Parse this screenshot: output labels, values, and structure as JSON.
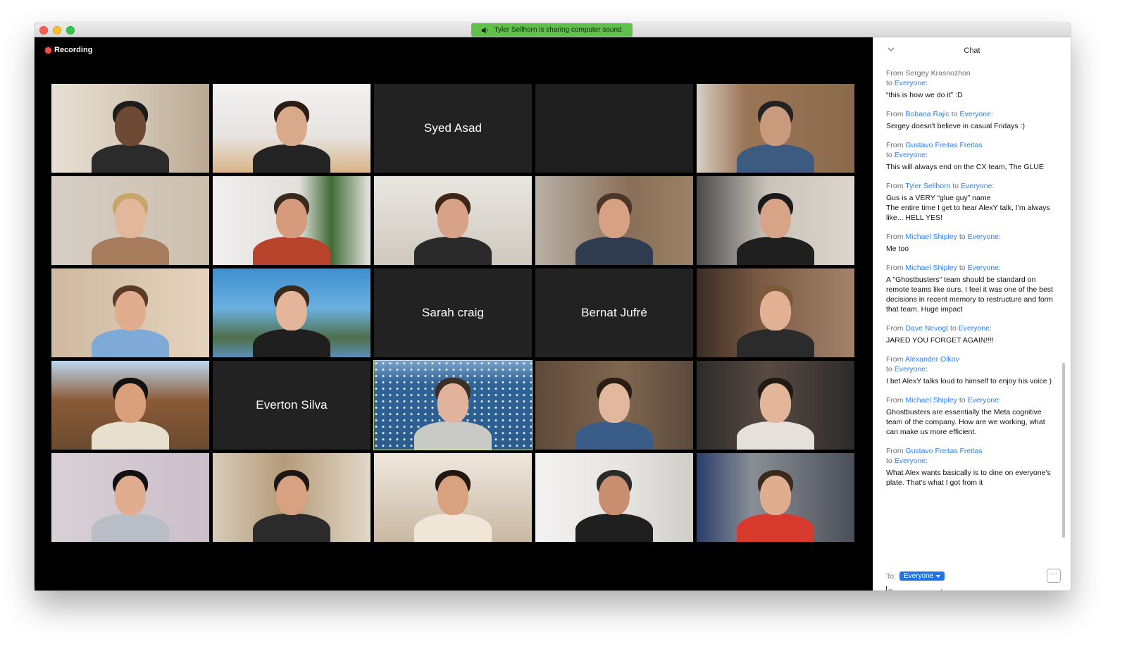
{
  "window": {
    "share_banner": "Tyler Sellhorn is sharing computer sound",
    "share_icon": "speaker-icon",
    "recording_label": "Recording"
  },
  "grid": {
    "tiles": [
      {
        "type": "video",
        "label": "participant-video-1"
      },
      {
        "type": "video",
        "label": "participant-video-2"
      },
      {
        "type": "name",
        "name": "Syed Asad"
      },
      {
        "type": "blank",
        "name": ""
      },
      {
        "type": "video",
        "label": "participant-video-5"
      },
      {
        "type": "video",
        "label": "participant-video-6"
      },
      {
        "type": "video",
        "label": "participant-video-7"
      },
      {
        "type": "video",
        "label": "participant-video-8"
      },
      {
        "type": "video",
        "label": "participant-video-9"
      },
      {
        "type": "video",
        "label": "participant-video-10"
      },
      {
        "type": "video",
        "label": "participant-video-11"
      },
      {
        "type": "video",
        "label": "participant-video-12"
      },
      {
        "type": "name",
        "name": "Sarah craig"
      },
      {
        "type": "name",
        "name": "Bernat Jufré"
      },
      {
        "type": "video",
        "label": "participant-video-15"
      },
      {
        "type": "video",
        "label": "participant-video-16"
      },
      {
        "type": "name",
        "name": "Everton Silva"
      },
      {
        "type": "video",
        "label": "participant-video-active-speaker",
        "active": true
      },
      {
        "type": "video",
        "label": "participant-video-19"
      },
      {
        "type": "video",
        "label": "participant-video-20"
      },
      {
        "type": "video",
        "label": "participant-video-21"
      },
      {
        "type": "video",
        "label": "participant-video-22"
      },
      {
        "type": "video",
        "label": "participant-video-23"
      },
      {
        "type": "video",
        "label": "participant-video-24"
      },
      {
        "type": "video",
        "label": "participant-video-25"
      }
    ]
  },
  "chat": {
    "title": "Chat",
    "from_prefix": "From",
    "to_word": "to",
    "messages": [
      {
        "sender": "Sergey Krasnozhon",
        "sender_is_link": false,
        "recipient": "Everyone",
        "break_before_to": true,
        "text": "“this is how we do it” :D"
      },
      {
        "sender": "Bobana Rajic",
        "sender_is_link": true,
        "recipient": "Everyone",
        "break_before_to": false,
        "text": "Sergey doesn't believe in casual Fridays :)"
      },
      {
        "sender": "Gustavo Freitas Freitas",
        "sender_is_link": true,
        "recipient": "Everyone",
        "break_before_to": true,
        "text": "This will always end on the CX team, The GLUE"
      },
      {
        "sender": "Tyler Sellhorn",
        "sender_is_link": true,
        "recipient": "Everyone",
        "break_before_to": false,
        "text": "Gus is a VERY “glue guy” name\nThe entire time I get to hear AlexY talk, I’m always like... HELL YES!"
      },
      {
        "sender": "Michael Shipley",
        "sender_is_link": true,
        "recipient": "Everyone",
        "break_before_to": false,
        "text": "Me too"
      },
      {
        "sender": "Michael Shipley",
        "sender_is_link": true,
        "recipient": "Everyone",
        "break_before_to": false,
        "text": "A \"Ghostbusters\" team should be standard on remote teams like ours. I feel it was one of the best decisions in recent memory to restructure and form that team. Huge impact"
      },
      {
        "sender": "Dave Nevogt",
        "sender_is_link": true,
        "recipient": "Everyone",
        "break_before_to": false,
        "text": "JARED YOU FORGET AGAIN!!!!"
      },
      {
        "sender": "Alexander Olkov",
        "sender_is_link": true,
        "recipient": "Everyone",
        "break_before_to": true,
        "text": "I bet AlexY talks loud to himself to enjoy his voice )"
      },
      {
        "sender": "Michael Shipley",
        "sender_is_link": true,
        "recipient": "Everyone",
        "break_before_to": false,
        "text": "Ghostbusters are essentially the Meta cognitive team of the company. How are we working, what can make us more efficient."
      },
      {
        "sender": "Gustavo Freitas Freitas",
        "sender_is_link": true,
        "recipient": "Everyone",
        "break_before_to": true,
        "text": "What Alex wants basically is to dine on everyone's plate. That's what I got from it"
      }
    ],
    "to_label": "To:",
    "recipient_selected": "Everyone",
    "more_label": "···",
    "input_value": "",
    "input_placeholder": "Type message here...",
    "colors": {
      "link": "#2d7ff0",
      "select_bg": "#1f72e8"
    }
  },
  "colors": {
    "share_banner": "#5fc14a",
    "recording_dot": "#f0524a",
    "active_speaker_border": "#cfe67a",
    "name_tile_bg": "#222222"
  }
}
